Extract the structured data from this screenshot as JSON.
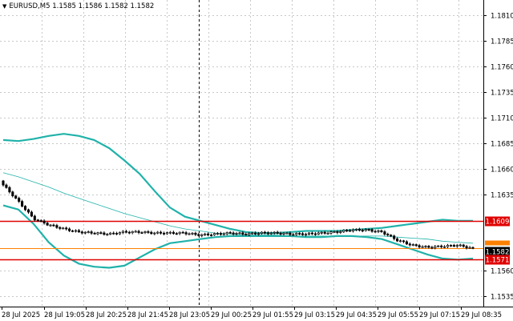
{
  "header": {
    "symbol_label": "EURUSD,M5",
    "ohlc": "1.1585 1.1586 1.1582 1.1582"
  },
  "colors": {
    "background": "#ffffff",
    "grid": "#c8c8c8",
    "axis": "#000000",
    "candle": "#000000",
    "bollinger": "#20b2aa",
    "moving_average": "#20b2aa",
    "resistance": "#e00000",
    "support": "#e00000",
    "current_price": "#ff8000"
  },
  "price_axis": {
    "ticks": [
      "1.1810",
      "1.1785",
      "1.1760",
      "1.1735",
      "1.1710",
      "1.1685",
      "1.1660",
      "1.1635",
      "1.1560",
      "1.1535"
    ]
  },
  "time_axis": {
    "ticks": [
      "28 Jul 2025",
      "28 Jul 19:05",
      "28 Jul 20:25",
      "28 Jul 21:45",
      "28 Jul 23:05",
      "29 Jul 00:25",
      "29 Jul 01:55",
      "29 Jul 03:15",
      "29 Jul 04:35",
      "29 Jul 05:55",
      "29 Jul 07:15",
      "29 Jul 08:35"
    ]
  },
  "price_labels": {
    "resistance": "1.1609",
    "current": "1.1582",
    "support": "1.1571"
  },
  "chart_data": {
    "type": "candlestick",
    "symbol": "EURUSD",
    "timeframe": "M5",
    "ylim": [
      1.1525,
      1.1825
    ],
    "levels": {
      "resistance": 1.1609,
      "support": 1.1571,
      "current": 1.1582
    },
    "bollinger_upper": [
      1.1688,
      1.1687,
      1.1689,
      1.1692,
      1.1694,
      1.1692,
      1.1688,
      1.168,
      1.1668,
      1.1655,
      1.1638,
      1.1622,
      1.1613,
      1.1609,
      1.1605,
      1.1601,
      1.1598,
      1.1597,
      1.1597,
      1.1598,
      1.1599,
      1.1599,
      1.1599,
      1.16,
      1.1601,
      1.1602,
      1.1604,
      1.1606,
      1.1608,
      1.161,
      1.1609,
      1.1609
    ],
    "bollinger_lower": [
      1.1624,
      1.162,
      1.1606,
      1.1588,
      1.1575,
      1.1567,
      1.1564,
      1.1563,
      1.1565,
      1.1573,
      1.1581,
      1.1587,
      1.1589,
      1.1591,
      1.1593,
      1.1594,
      1.1594,
      1.1594,
      1.1594,
      1.1594,
      1.1593,
      1.1593,
      1.1594,
      1.1594,
      1.1593,
      1.1591,
      1.1586,
      1.1581,
      1.1576,
      1.1572,
      1.1571,
      1.1572
    ],
    "moving_average": [
      1.1656,
      1.1652,
      1.1647,
      1.1642,
      1.1636,
      1.1631,
      1.1626,
      1.1621,
      1.1616,
      1.1612,
      1.1608,
      1.1604,
      1.1601,
      1.1599,
      1.1597,
      1.1596,
      1.1595,
      1.1595,
      1.1595,
      1.1594,
      1.1594,
      1.1594,
      1.1594,
      1.1594,
      1.1594,
      1.1594,
      1.1593,
      1.1592,
      1.1591,
      1.1589,
      1.1588,
      1.1587
    ],
    "close": [
      1.1644,
      1.1628,
      1.1611,
      1.1605,
      1.1601,
      1.1598,
      1.1597,
      1.1596,
      1.1598,
      1.1598,
      1.1597,
      1.1597,
      1.1597,
      1.1595,
      1.1596,
      1.1597,
      1.1596,
      1.1597,
      1.1597,
      1.1596,
      1.1596,
      1.1597,
      1.1598,
      1.16,
      1.16,
      1.1598,
      1.159,
      1.1585,
      1.1583,
      1.1584,
      1.1585,
      1.1582
    ]
  }
}
